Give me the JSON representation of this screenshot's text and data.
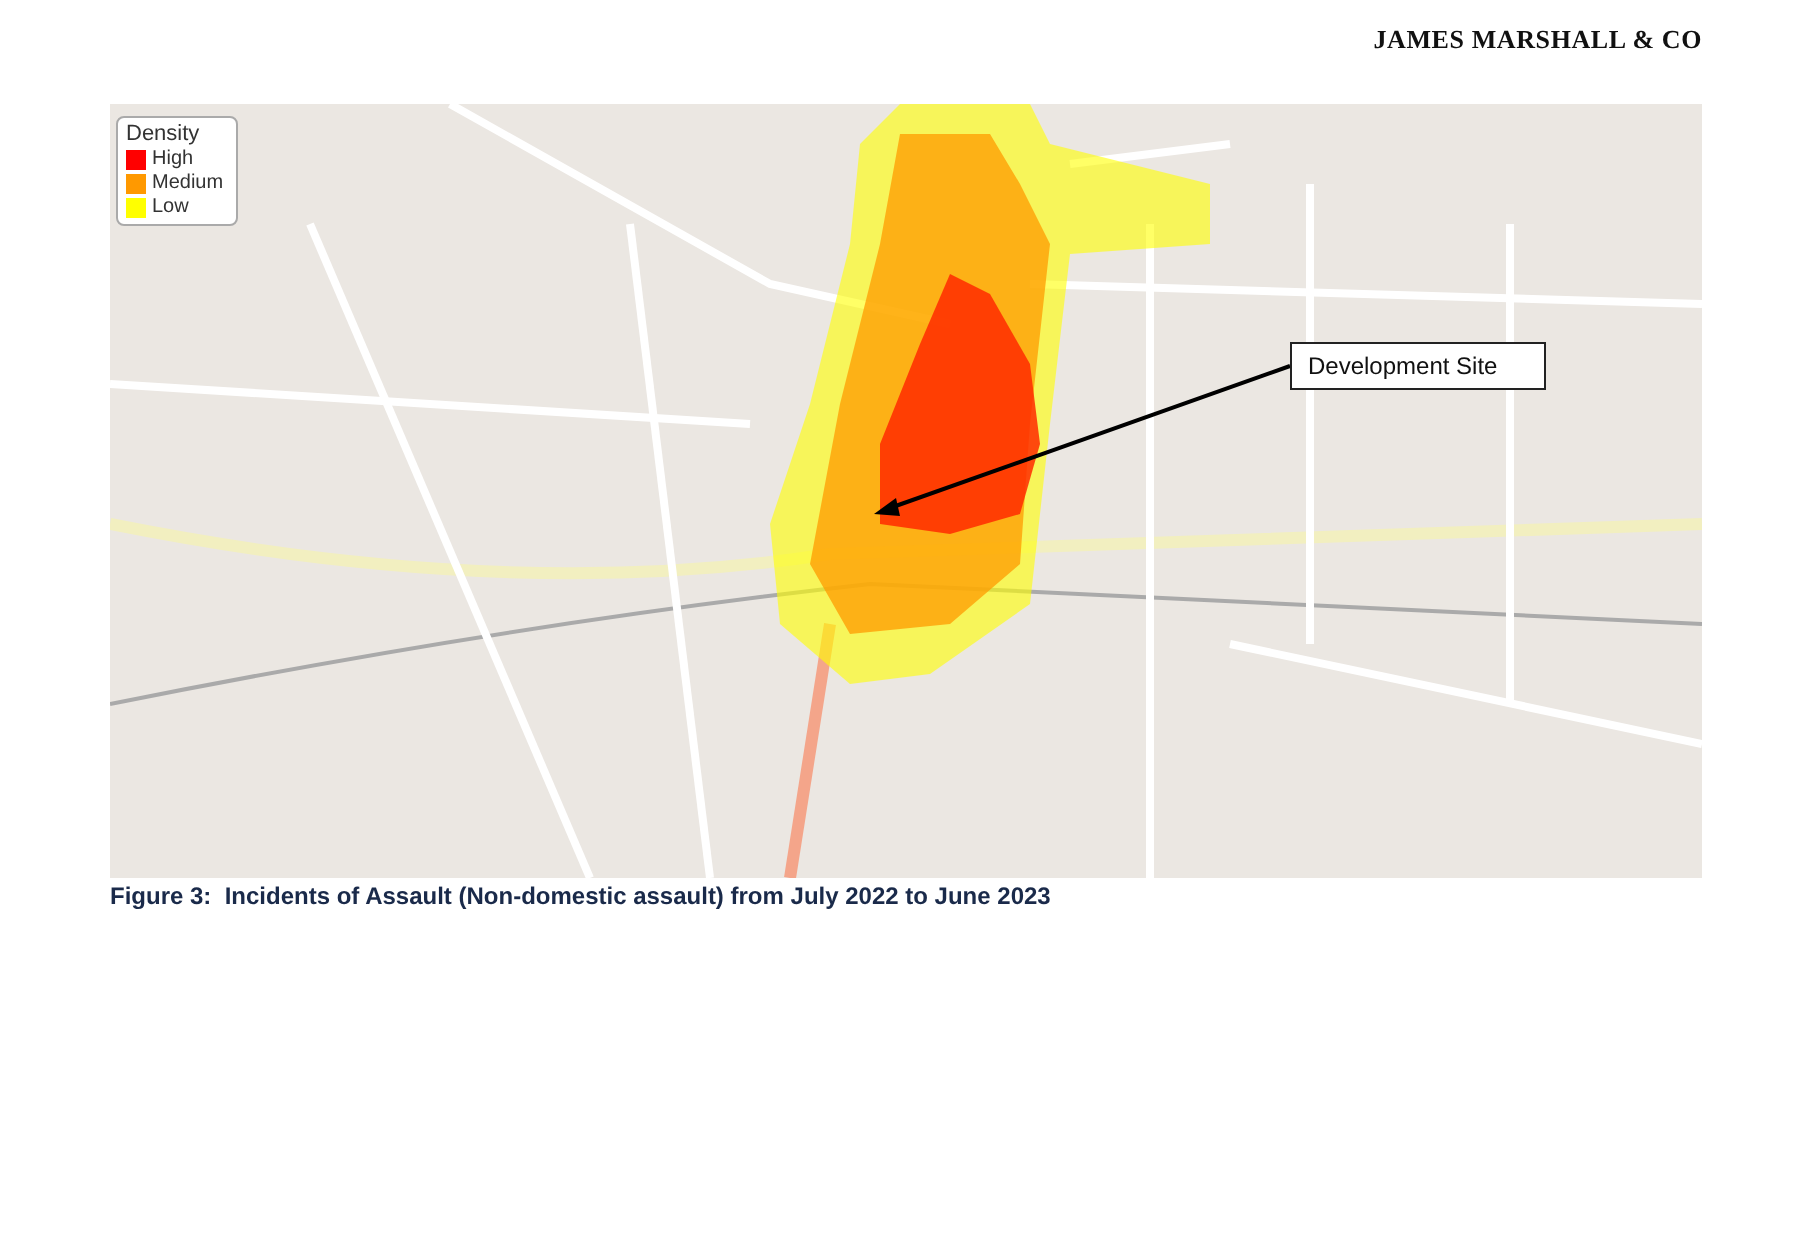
{
  "header": {
    "company": "JAMES MARSHALL & CO"
  },
  "map": {
    "legend": {
      "title": "Density",
      "items": [
        {
          "label": "High",
          "color": "#ff0000"
        },
        {
          "label": "Medium",
          "color": "#ff9900"
        },
        {
          "label": "Low",
          "color": "#ffff00"
        }
      ]
    },
    "callout": "Development Site"
  },
  "caption": "Figure 3:  Incidents of Assault (Non-domestic assault) from July 2022 to June 2023"
}
